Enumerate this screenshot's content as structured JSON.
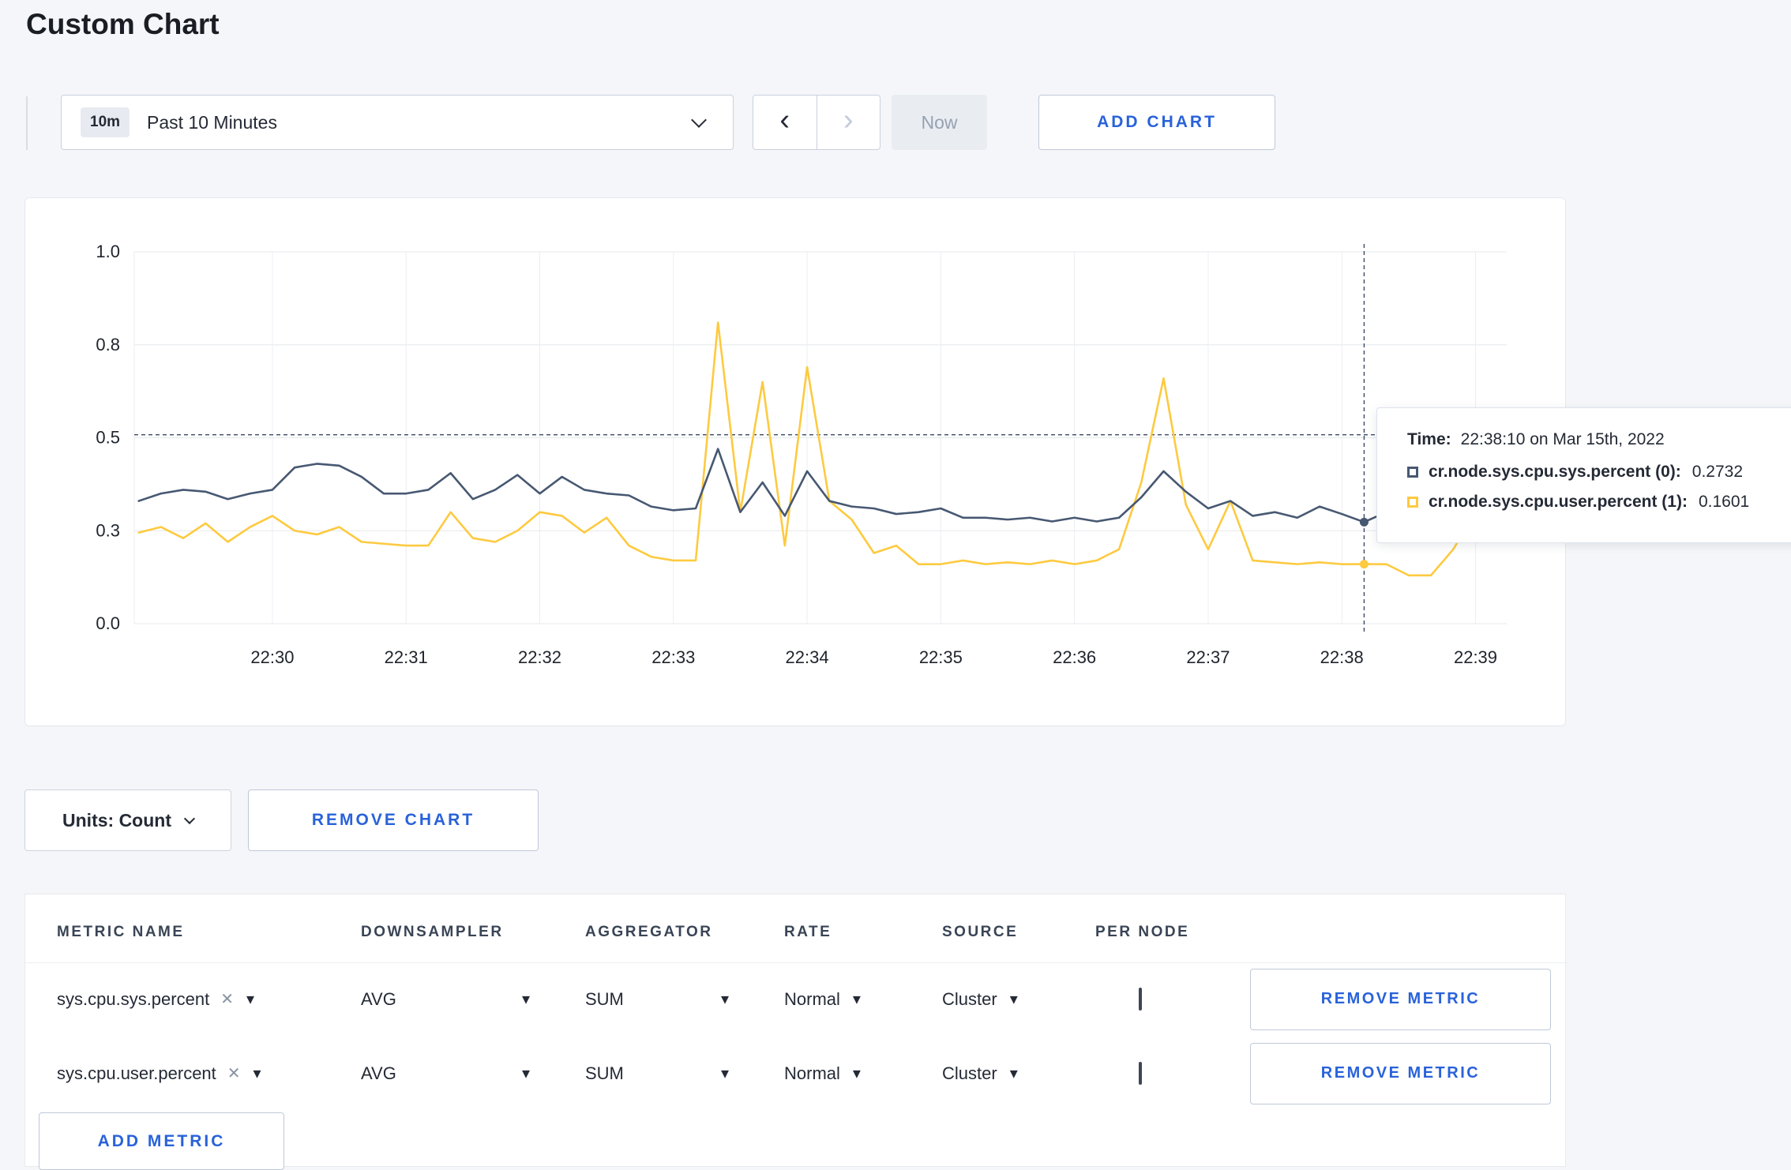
{
  "page": {
    "title": "Custom Chart"
  },
  "toolbar": {
    "time_badge": "10m",
    "time_label": "Past 10 Minutes",
    "now_label": "Now",
    "add_chart_label": "ADD CHART"
  },
  "icons": {
    "prev": "‹",
    "next": "›",
    "clear": "✕",
    "caret_down": "▾"
  },
  "tooltip": {
    "time_label": "Time:",
    "time_value": "22:38:10 on Mar 15th, 2022",
    "series": [
      {
        "name": "cr.node.sys.cpu.sys.percent (0):",
        "value": "0.2732",
        "color": "#475872"
      },
      {
        "name": "cr.node.sys.cpu.user.percent (1):",
        "value": "0.1601",
        "color": "#fdca40"
      }
    ]
  },
  "chart_data": {
    "type": "line",
    "title": "",
    "xlabel": "",
    "ylabel": "",
    "x_start_time": "22:29:00",
    "interval_seconds": 10,
    "x_domain_indices": [
      -0.2,
      61.4
    ],
    "x_tick_indices": [
      6,
      12,
      18,
      24,
      30,
      36,
      42,
      48,
      54,
      60
    ],
    "x_tick_labels": [
      "22:30",
      "22:31",
      "22:32",
      "22:33",
      "22:34",
      "22:35",
      "22:36",
      "22:37",
      "22:38",
      "22:39"
    ],
    "y_ticks": {
      "values": [
        0,
        0.25,
        0.5,
        0.75,
        1.0
      ],
      "labels": [
        "0.0",
        "0.3",
        "0.5",
        "0.8",
        "1.0"
      ]
    },
    "ylim": [
      0,
      1.0
    ],
    "grid": true,
    "series": [
      {
        "name": "cr.node.sys.cpu.sys.percent",
        "color": "#475872",
        "values": [
          0.33,
          0.35,
          0.36,
          0.355,
          0.335,
          0.35,
          0.36,
          0.42,
          0.43,
          0.425,
          0.395,
          0.35,
          0.35,
          0.36,
          0.405,
          0.335,
          0.36,
          0.4,
          0.35,
          0.395,
          0.36,
          0.35,
          0.345,
          0.315,
          0.305,
          0.31,
          0.47,
          0.3,
          0.38,
          0.29,
          0.41,
          0.33,
          0.315,
          0.31,
          0.295,
          0.3,
          0.31,
          0.285,
          0.285,
          0.28,
          0.285,
          0.275,
          0.285,
          0.275,
          0.285,
          0.34,
          0.41,
          0.355,
          0.31,
          0.33,
          0.29,
          0.3,
          0.285,
          0.315,
          0.295,
          0.2732,
          0.3,
          0.31,
          0.3,
          0.295,
          0.3,
          0.31
        ]
      },
      {
        "name": "cr.node.sys.cpu.user.percent",
        "color": "#fdca40",
        "values": [
          0.245,
          0.26,
          0.23,
          0.27,
          0.22,
          0.26,
          0.29,
          0.25,
          0.24,
          0.26,
          0.22,
          0.215,
          0.21,
          0.21,
          0.3,
          0.23,
          0.22,
          0.25,
          0.3,
          0.29,
          0.245,
          0.285,
          0.21,
          0.18,
          0.17,
          0.17,
          0.81,
          0.3,
          0.65,
          0.21,
          0.69,
          0.33,
          0.28,
          0.19,
          0.21,
          0.16,
          0.16,
          0.17,
          0.16,
          0.165,
          0.16,
          0.17,
          0.16,
          0.17,
          0.2,
          0.38,
          0.66,
          0.32,
          0.2,
          0.33,
          0.17,
          0.165,
          0.16,
          0.165,
          0.16,
          0.1601,
          0.16,
          0.13,
          0.13,
          0.2,
          0.3,
          0.24
        ]
      }
    ],
    "crosshair": {
      "time": "22:38:10",
      "x_index": 55,
      "y_value": 0.508
    },
    "highlight": [
      {
        "series": 0,
        "value": 0.2732
      },
      {
        "series": 1,
        "value": 0.1601
      }
    ]
  },
  "chart_controls": {
    "units_label": "Units: Count",
    "remove_chart_label": "REMOVE CHART"
  },
  "metrics_table": {
    "headers": [
      "METRIC NAME",
      "DOWNSAMPLER",
      "AGGREGATOR",
      "RATE",
      "SOURCE",
      "PER NODE"
    ],
    "rows": [
      {
        "metric": "sys.cpu.sys.percent",
        "downsampler": "AVG",
        "aggregator": "SUM",
        "rate": "Normal",
        "source": "Cluster",
        "per_node": false,
        "remove_label": "REMOVE METRIC"
      },
      {
        "metric": "sys.cpu.user.percent",
        "downsampler": "AVG",
        "aggregator": "SUM",
        "rate": "Normal",
        "source": "Cluster",
        "per_node": false,
        "remove_label": "REMOVE METRIC"
      }
    ],
    "add_metric_label": "ADD METRIC"
  },
  "colors": {
    "accent": "#2962d9",
    "series_sys": "#475872",
    "series_user": "#fdca40"
  }
}
